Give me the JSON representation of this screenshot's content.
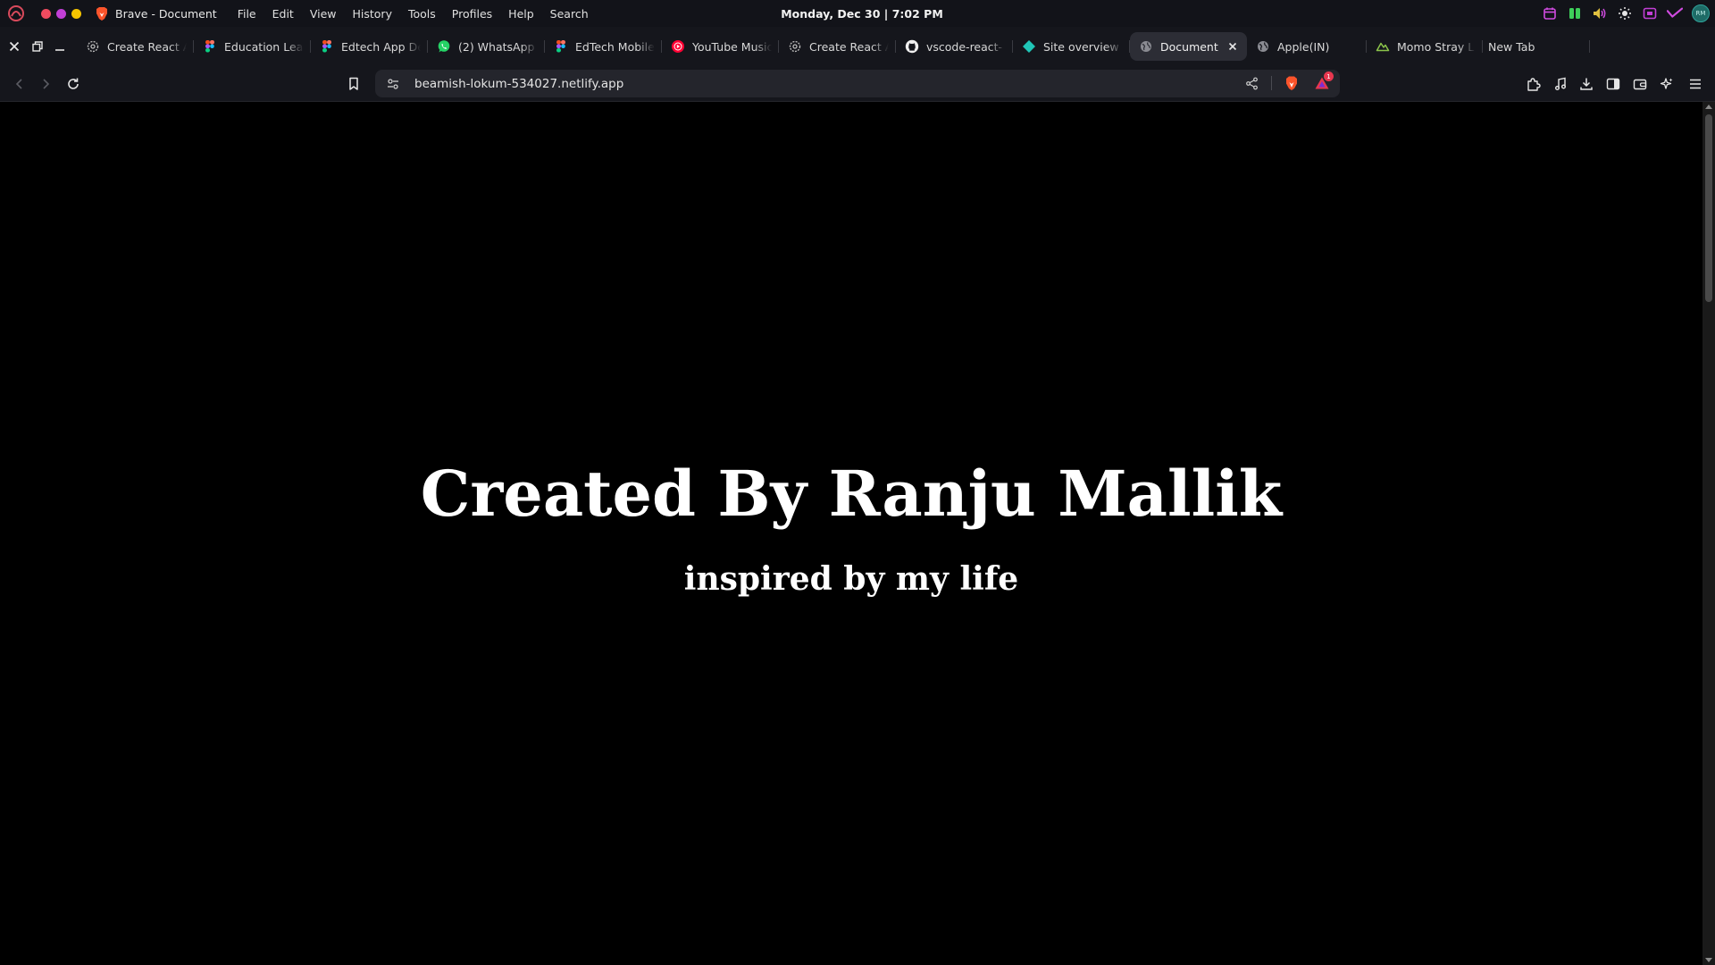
{
  "system_bar": {
    "app_title": "Brave - Document",
    "menus": [
      "File",
      "Edit",
      "View",
      "History",
      "Tools",
      "Profiles",
      "Help",
      "Search"
    ],
    "clock": "Monday, Dec 30 | 7:02 PM",
    "colors": {
      "close": "#ef4b5f",
      "minimize": "#c23fd6",
      "maximize": "#f5c400"
    },
    "tray_icons": [
      "calendar-icon",
      "media-bars-icon",
      "volume-icon",
      "brightness-icon",
      "screen-recorder-icon",
      "vpn-check-icon",
      "user-avatar"
    ],
    "avatar_text": "RM"
  },
  "tabs": [
    {
      "title": "Create React A",
      "icon": "gear-favicon-icon",
      "active": false
    },
    {
      "title": "Education Lea",
      "icon": "figma-favicon-icon",
      "active": false
    },
    {
      "title": "Edtech App De",
      "icon": "figma-favicon-icon",
      "active": false
    },
    {
      "title": "(2) WhatsApp",
      "icon": "whatsapp-favicon-icon",
      "active": false
    },
    {
      "title": "EdTech Mobile",
      "icon": "figma-favicon-icon",
      "active": false
    },
    {
      "title": "YouTube Music",
      "icon": "youtube-music-favicon-icon",
      "active": false
    },
    {
      "title": "Create React A",
      "icon": "gear-favicon-icon",
      "active": false
    },
    {
      "title": "vscode-react-",
      "icon": "github-favicon-icon",
      "active": false
    },
    {
      "title": "Site overview",
      "icon": "netlify-favicon-icon",
      "active": false
    },
    {
      "title": "Document",
      "icon": "globe-favicon-icon",
      "active": true
    },
    {
      "title": "Apple(IN)",
      "icon": "globe-favicon-icon",
      "active": false
    },
    {
      "title": "Momo Stray L",
      "icon": "cloud-favicon-icon",
      "active": false
    },
    {
      "title": "New Tab",
      "icon": "",
      "active": false
    }
  ],
  "toolbar": {
    "url": "beamish-lokum-534027.netlify.app",
    "rewards_badge": "1"
  },
  "page": {
    "headline": "Created By Ranju Mallik",
    "subline": "inspired by my life"
  }
}
